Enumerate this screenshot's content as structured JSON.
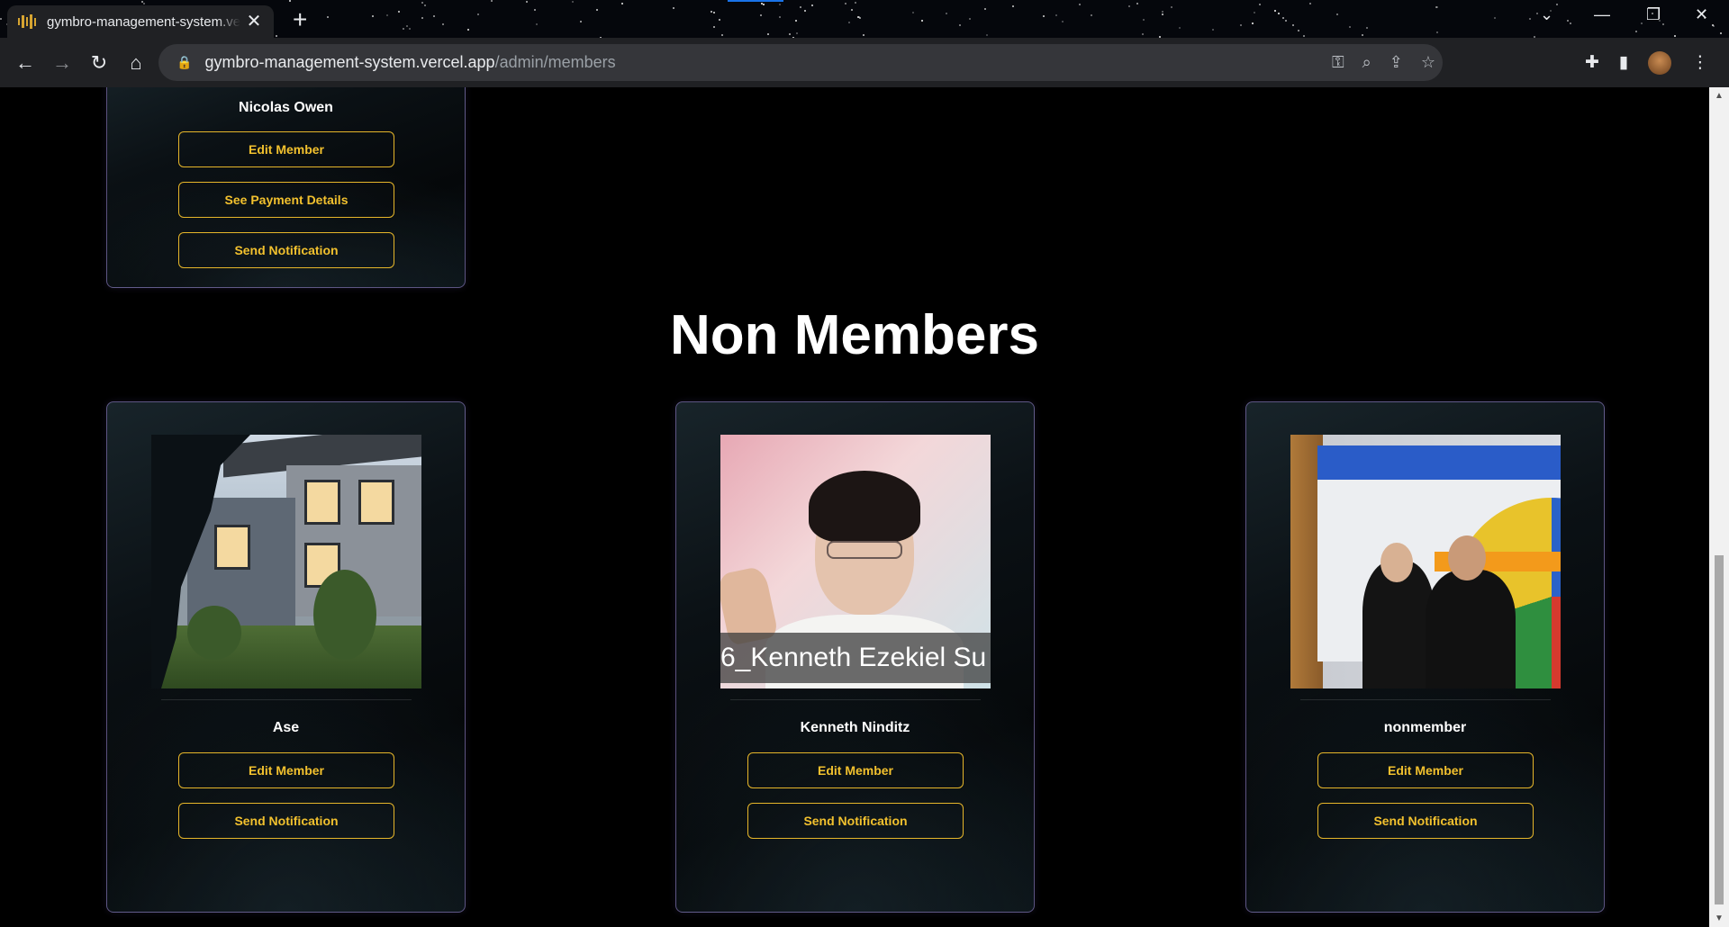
{
  "browser": {
    "tab_title": "gymbro-management-system.vercel.app",
    "url_host": "gymbro-management-system.vercel.app",
    "url_path": "/admin/members"
  },
  "members_section": {
    "partial_card": {
      "name": "Nicolas Owen",
      "buttons": [
        "Edit Member",
        "See Payment Details",
        "Send Notification"
      ]
    }
  },
  "non_members": {
    "title": "Non Members",
    "cards": [
      {
        "name": "Ase",
        "photo": "house-photo",
        "buttons": [
          "Edit Member",
          "Send Notification"
        ]
      },
      {
        "name": "Kenneth Ninditz",
        "photo": "person-photo",
        "photo_caption": "6_Kenneth Ezekiel Su",
        "buttons": [
          "Edit Member",
          "Send Notification"
        ]
      },
      {
        "name": "nonmember",
        "photo": "event-photo",
        "buttons": [
          "Edit Member",
          "Send Notification"
        ]
      }
    ]
  },
  "colors": {
    "accent": "#f2c12e",
    "card_border": "#a08cdc",
    "background": "#000000"
  }
}
